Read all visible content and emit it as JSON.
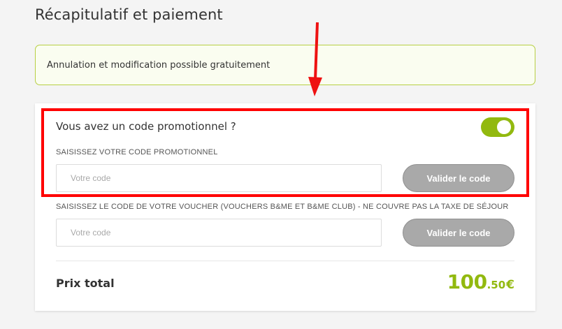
{
  "page": {
    "title": "Récapitulatif et paiement"
  },
  "notice": {
    "text": "Annulation et modification possible gratuitement"
  },
  "promo": {
    "question": "Vous avez un code promotionnel ?",
    "toggle_on": true,
    "label": "SAISISSEZ VOTRE CODE PROMOTIONNEL",
    "placeholder": "Votre code",
    "value": "",
    "button_label": "Valider le code"
  },
  "voucher": {
    "label": "SAISISSEZ LE CODE DE VOTRE VOUCHER (VOUCHERS B&ME ET B&ME CLUB) - NE COUVRE PAS LA TAXE DE SÉJOUR",
    "placeholder": "Votre code",
    "value": "",
    "button_label": "Valider le code"
  },
  "total": {
    "label": "Prix total",
    "price_integer": "100",
    "price_decimal": ".50",
    "currency": "€"
  },
  "colors": {
    "accent_green": "#92b90f",
    "notice_border": "#b7cf43",
    "button_disabled": "#a9a9a9",
    "annotation_red": "#ff0000"
  }
}
